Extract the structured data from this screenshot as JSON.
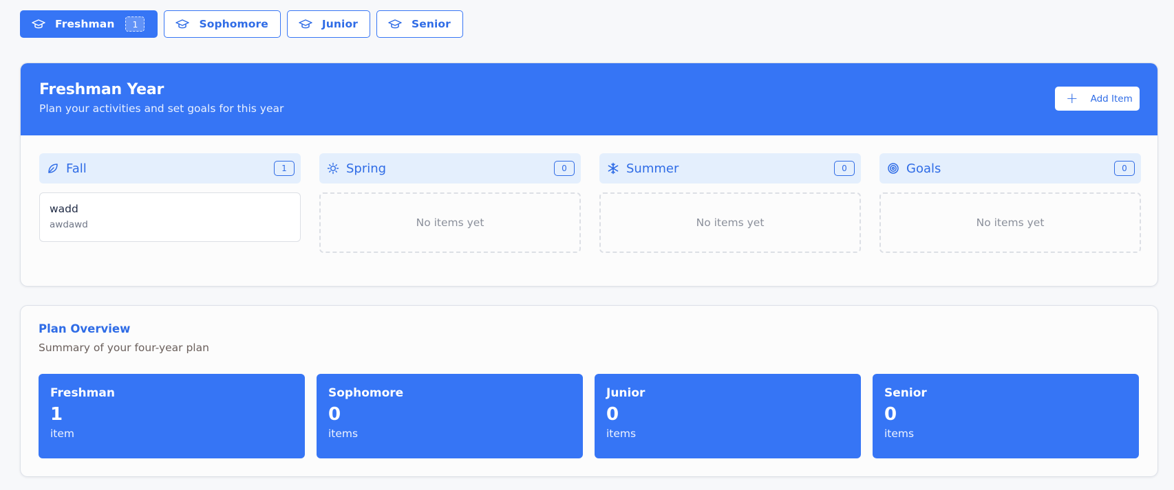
{
  "tabs": [
    {
      "label": "Freshman",
      "badge": "1",
      "active": true
    },
    {
      "label": "Sophomore",
      "active": false
    },
    {
      "label": "Junior",
      "active": false
    },
    {
      "label": "Senior",
      "active": false
    }
  ],
  "year_panel": {
    "title": "Freshman Year",
    "subtitle": "Plan your activities and set goals for this year",
    "add_button_label": "Add Item"
  },
  "seasons": [
    {
      "name": "Fall",
      "icon": "leaf-icon",
      "count": "1",
      "items": [
        {
          "title": "wadd",
          "description": "awdawd"
        }
      ]
    },
    {
      "name": "Spring",
      "icon": "sun-icon",
      "count": "0",
      "empty_text": "No items yet"
    },
    {
      "name": "Summer",
      "icon": "snowflake-icon",
      "count": "0",
      "empty_text": "No items yet"
    },
    {
      "name": "Goals",
      "icon": "target-icon",
      "count": "0",
      "empty_text": "No items yet"
    }
  ],
  "overview": {
    "title": "Plan Overview",
    "subtitle": "Summary of your four-year plan",
    "cards": [
      {
        "year": "Freshman",
        "count": "1",
        "unit": "item"
      },
      {
        "year": "Sophomore",
        "count": "0",
        "unit": "items"
      },
      {
        "year": "Junior",
        "count": "0",
        "unit": "items"
      },
      {
        "year": "Senior",
        "count": "0",
        "unit": "items"
      }
    ]
  },
  "colors": {
    "accent": "#3675f5",
    "accent_light": "#e4effd",
    "page_bg": "#f7f8fa"
  }
}
